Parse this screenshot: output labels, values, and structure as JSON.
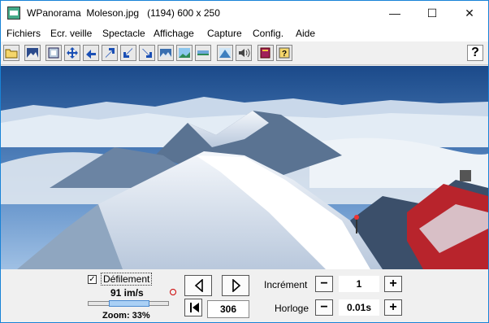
{
  "titlebar": {
    "title": "WPanorama  Moleson.jpg   (1194) 600 x 250",
    "minimize": "—",
    "maximize": "☐",
    "close": "✕"
  },
  "menu": [
    "Fichiers",
    "Ecr. veille",
    "Spectacle",
    "Affichage",
    "Capture",
    "Config.",
    "Aide"
  ],
  "toolbar": {
    "help": "?"
  },
  "controls": {
    "defilement_label": "Défilement",
    "defilement_checked": "✓",
    "speed": "91 im/s",
    "zoom": "Zoom: 33%",
    "position": "306",
    "increment_label": "Incrément",
    "increment_value": "1",
    "clock_label": "Horloge",
    "clock_value": "0.01s",
    "minus": "−",
    "plus": "+"
  }
}
